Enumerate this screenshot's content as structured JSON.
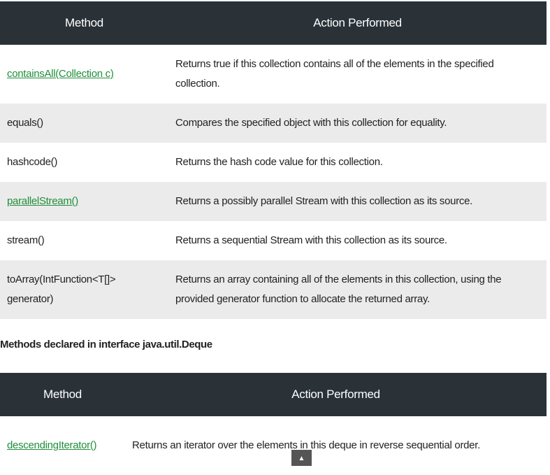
{
  "table1": {
    "headers": [
      "Method",
      "Action Performed"
    ],
    "rows": [
      {
        "method": "containsAll(Collection c)",
        "link": true,
        "action": "Returns true if this collection contains all of the elements in the specified collection."
      },
      {
        "method": "equals()",
        "link": false,
        "action": "Compares the specified object with this collection for equality."
      },
      {
        "method": "hashcode()",
        "link": false,
        "action": "Returns the hash code value for this collection."
      },
      {
        "method": "parallelStream()",
        "link": true,
        "action": "Returns a possibly parallel Stream with this collection as its source."
      },
      {
        "method": "stream()",
        "link": false,
        "action": "Returns a sequential Stream with this collection as its source."
      },
      {
        "method": "toArray(IntFunction<T[]> generator)",
        "link": false,
        "action": "Returns an array containing all of the elements in this collection, using the provided generator function to allocate the returned array."
      }
    ]
  },
  "section_title": "Methods declared in interface java.util.Deque",
  "table2": {
    "headers": [
      "Method",
      "Action Performed"
    ],
    "rows": [
      {
        "method": "descendingIterator()",
        "link": true,
        "action": "Returns an iterator over the elements in this deque in reverse sequential order."
      }
    ]
  },
  "scroll_top": {
    "icon": "arrow-up-icon",
    "glyph": "▲"
  },
  "colors": {
    "header_bg": "#2a3238",
    "link": "#1f8f3a",
    "stripe": "#ebebeb"
  }
}
